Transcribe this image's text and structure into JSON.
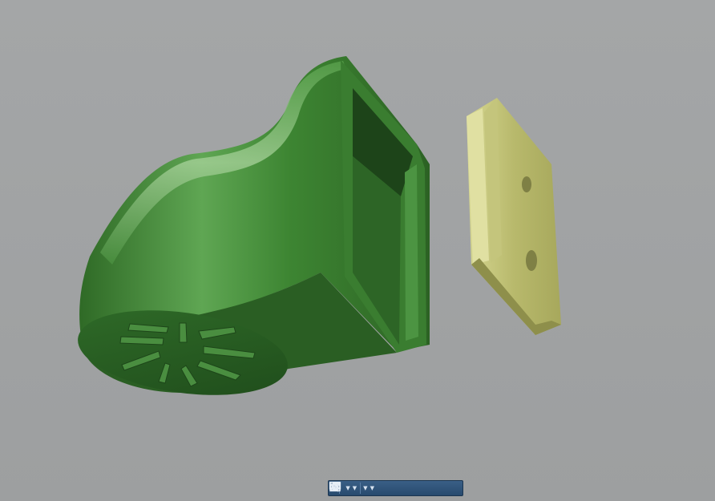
{
  "app": {
    "type": "cad-3d-viewport"
  },
  "viewport": {
    "background": "#9fa1a2",
    "parts": [
      {
        "name": "clip-body",
        "color": "#3f8a33"
      },
      {
        "name": "slide-plate",
        "color": "#c6c77f"
      }
    ]
  },
  "navigation_toolbar": {
    "buttons": [
      {
        "icon": "orbit-icon",
        "has_dropdown": true
      },
      {
        "icon": "look-at-icon",
        "has_dropdown": false
      },
      {
        "icon": "pan-hand-icon",
        "has_dropdown": false
      },
      {
        "icon": "zoom-icon",
        "has_dropdown": true
      },
      {
        "icon": "fit-window-icon",
        "has_dropdown": true
      },
      {
        "icon": "display-settings-icon",
        "has_dropdown": true
      },
      {
        "icon": "grid-icon",
        "has_dropdown": true
      }
    ]
  }
}
